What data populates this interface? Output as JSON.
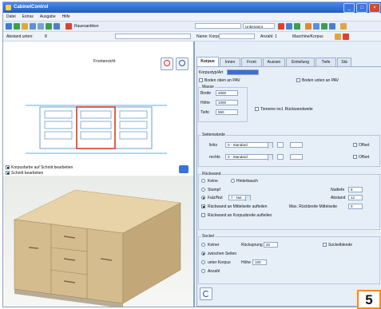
{
  "app": {
    "title": "CabinetControl"
  },
  "menu": [
    "Datei",
    "Extras",
    "Ausgabe",
    "Hilfe"
  ],
  "toolbar": {
    "style_label": "Rauesantiken",
    "search_value": "",
    "object_value": "Unbenannt",
    "extra_fields": [
      "",
      ""
    ]
  },
  "address": {
    "label": "Abstand unten:",
    "value": "8"
  },
  "header": {
    "name_label": "Name: Korpus 1",
    "count_label": "Anzahl: 1",
    "material_label": "Maschine/Korpus"
  },
  "tabs": [
    "Korpus",
    "Innen",
    "Front",
    "Aussen",
    "Einteilung",
    "Tiefe",
    "Stä"
  ],
  "preview": {
    "title": "Frontansicht",
    "check1": "Korpusfarbe auf Schnitt bearbeiten",
    "check2": "Schnitt bearbeiten"
  },
  "korpus": {
    "type_label": "Korpustyp/Art",
    "type_value": "",
    "bottom_checkbox": "Boden oben an PAV",
    "top_checkbox": "Boden unten an PAV",
    "dims_title": "Masse",
    "breite_label": "Breite",
    "breite_value": "2000",
    "hoehe_label": "Höhe",
    "hoehe_value": "1000",
    "tiefe_label": "Tiefe",
    "tiefe_value": "550",
    "incl_label": "Tieneine incl. Rückwandweite"
  },
  "seitenwand": {
    "title": "Seitenwände",
    "links_label": "links",
    "links_value": "0 - Standard",
    "rechts_label": "rechts",
    "rechts_value": "0 - Standard",
    "offset_label_1": "Offset",
    "offset_label_2": "Offset"
  },
  "rueckwand": {
    "title": "Rückwand",
    "options": [
      "Keine",
      "Stumpf",
      "Falz/Nut"
    ],
    "bottom_options": [
      "Rückwand an Mittelseite aufteilen",
      "Rückwand an Korpusbreite aufteilen"
    ],
    "nut_value": "7 - Nut",
    "hinterbauch_label": "Hinterbauch",
    "nuttiefe_label": "Nuttiefe",
    "nuttiefe_value": "8",
    "abstand_label": "Abstand",
    "abstand_value": "12",
    "max_label": "Max. Rückbreite Mittelseite",
    "max_value": "0"
  },
  "sockel": {
    "title": "Sockel",
    "options": [
      "Keiner",
      "zwischen Seiten",
      "unter Korpus",
      "Anzahl"
    ],
    "ruecksprung_label": "Rücksprung",
    "ruecksprung_value": "20",
    "hoehe_label": "Höhe",
    "hoehe_value": "100",
    "sockelblende_label": "Sockelblende"
  },
  "figure_number": "5"
}
